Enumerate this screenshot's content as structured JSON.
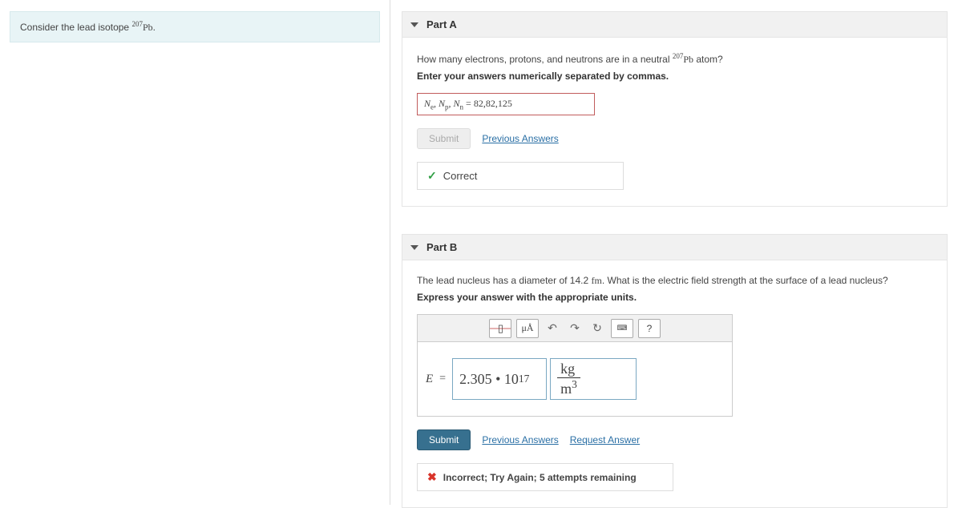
{
  "prompt": {
    "prefix": "Consider the lead isotope ",
    "isotope_sup": "207",
    "isotope_sym": "Pb",
    "suffix": "."
  },
  "partA": {
    "title": "Part A",
    "question_pre": "How many electrons, protons, and neutrons are in a neutral ",
    "iso_sup": "207",
    "iso_sym": "Pb",
    "question_post": " atom?",
    "instruction": "Enter your answers numerically separated by commas.",
    "field_prefix_html": "N_e, N_p, N_n = ",
    "vars": {
      "e": "e",
      "p": "p",
      "n": "n"
    },
    "value": "82,82,125",
    "submit_label": "Submit",
    "prev_link": "Previous Answers",
    "feedback": "Correct"
  },
  "partB": {
    "title": "Part B",
    "question_pre": "The lead nucleus has a diameter of 14.2 ",
    "unit_inline": "fm",
    "question_post": ". What is the electric field strength at the surface of a lead nucleus?",
    "instruction": "Express your answer with the appropriate units.",
    "toolbar": {
      "mu_a": "μÅ",
      "help": "?"
    },
    "answer": {
      "symbol": "E",
      "equals": "=",
      "value": "2.305 • 10",
      "exp": "17",
      "unit_top": "kg",
      "unit_bot_base": "m",
      "unit_bot_exp": "3"
    },
    "submit_label": "Submit",
    "prev_link": "Previous Answers",
    "req_link": "Request Answer",
    "feedback": "Incorrect; Try Again; 5 attempts remaining"
  }
}
